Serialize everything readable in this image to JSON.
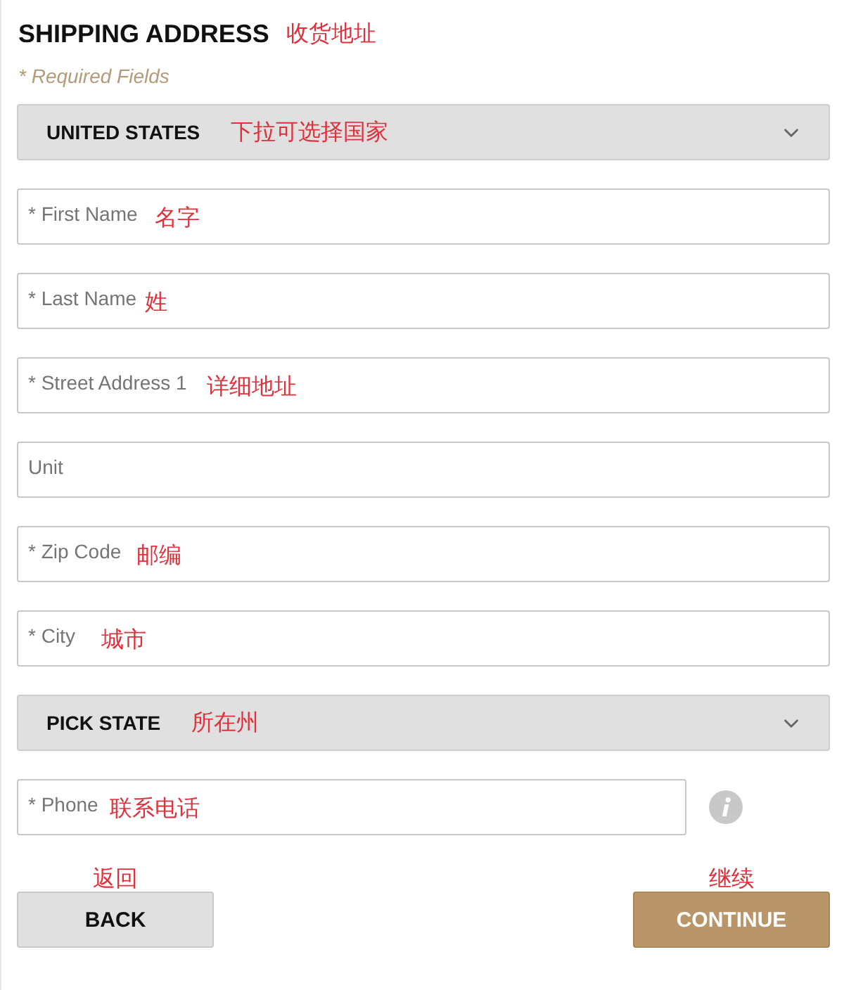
{
  "title": "SHIPPING ADDRESS",
  "title_note": "收货地址",
  "required_note": "* Required Fields",
  "rows": [
    {
      "kind": "select",
      "text": "UNITED STATES",
      "note": "下拉可选择国家"
    },
    {
      "kind": "input",
      "placeholder": "* First Name",
      "note": "名字"
    },
    {
      "kind": "input",
      "placeholder": "* Last Name",
      "note": "姓"
    },
    {
      "kind": "input",
      "placeholder": "* Street Address 1",
      "note": "详细地址"
    },
    {
      "kind": "input",
      "placeholder": "Unit"
    },
    {
      "kind": "input",
      "placeholder": "* Zip Code",
      "note": "邮编"
    },
    {
      "kind": "input",
      "placeholder": "* City",
      "note": "城市"
    },
    {
      "kind": "select",
      "text": "PICK STATE",
      "note": "所在州"
    },
    {
      "kind": "input",
      "placeholder": "* Phone",
      "note": "联系电话",
      "help_icon": true
    }
  ],
  "buttons": [
    {
      "kind": "secondary",
      "label": "BACK",
      "note": "返回"
    },
    {
      "kind": "primary",
      "label": "CONTINUE",
      "note": "继续"
    }
  ]
}
